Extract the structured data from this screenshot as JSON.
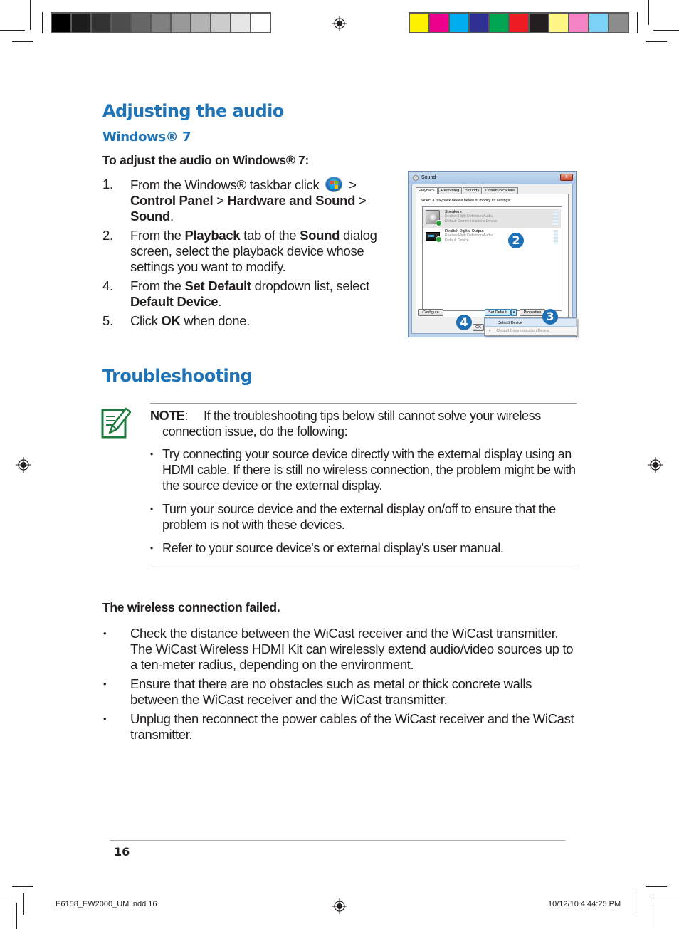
{
  "printer_marks": {
    "gray_swatches": [
      "#000000",
      "#1c1c1c",
      "#333333",
      "#4d4d4d",
      "#666666",
      "#808080",
      "#999999",
      "#b3b3b3",
      "#cccccc",
      "#e6e6e6",
      "#ffffff"
    ],
    "color_swatches": [
      "#fff200",
      "#ec008c",
      "#00aeef",
      "#2e3192",
      "#00a651",
      "#ed1c24",
      "#231f20",
      "#fff685",
      "#f584c5",
      "#7dd3f7",
      "#8c8c8c"
    ]
  },
  "section_audio": {
    "title": "Adjusting the audio",
    "subtitle": "Windows® 7",
    "procedure_heading": "To adjust the audio on Windows® 7:",
    "steps": [
      {
        "num": "1.",
        "parts": [
          {
            "t": "From the Windows® taskbar click ",
            "b": false
          },
          {
            "icon": "windows-start-orb-icon"
          },
          {
            "t": " > ",
            "b": false
          },
          {
            "t": "Control Panel",
            "b": true
          },
          {
            "t": " > ",
            "b": false
          },
          {
            "t": "Hardware and Sound",
            "b": true
          },
          {
            "t": " > ",
            "b": false
          },
          {
            "t": "Sound",
            "b": true
          },
          {
            "t": ".",
            "b": false
          }
        ]
      },
      {
        "num": "2.",
        "parts": [
          {
            "t": "From the ",
            "b": false
          },
          {
            "t": "Playback",
            "b": true
          },
          {
            "t": " tab of the ",
            "b": false
          },
          {
            "t": "Sound",
            "b": true
          },
          {
            "t": " dialog screen, select the playback device whose settings you want to modify.",
            "b": false
          }
        ]
      },
      {
        "num": "4.",
        "parts": [
          {
            "t": "From the ",
            "b": false
          },
          {
            "t": "Set Default",
            "b": true
          },
          {
            "t": " dropdown list, select ",
            "b": false
          },
          {
            "t": "Default Device",
            "b": true
          },
          {
            "t": ".",
            "b": false
          }
        ]
      },
      {
        "num": "5.",
        "parts": [
          {
            "t": "Click ",
            "b": false
          },
          {
            "t": "OK",
            "b": true
          },
          {
            "t": " when done.",
            "b": false
          }
        ]
      }
    ]
  },
  "sound_dialog": {
    "title": "Sound",
    "close_label": "x",
    "tabs": [
      "Playback",
      "Recording",
      "Sounds",
      "Communications"
    ],
    "active_tab": "Playback",
    "instruction": "Select a playback device below to modify its settings:",
    "devices": [
      {
        "name": "Speakers",
        "driver": "Realtek High Definition Audio",
        "status": "Default Communications Device",
        "selected": true
      },
      {
        "name": "Realtek Digital Output",
        "driver": "Realtek High Definition Audio",
        "status": "Default Device",
        "selected": false
      }
    ],
    "buttons": {
      "configure": "Configure",
      "set_default": "Set Default",
      "properties": "Properties",
      "ok": "OK"
    },
    "dropdown_menu": [
      {
        "label": "Default Device",
        "checked": false,
        "highlighted": true
      },
      {
        "label": "Default Communication Device",
        "checked": true,
        "highlighted": false
      }
    ],
    "check_glyph": "✓",
    "callouts": [
      "2",
      "3",
      "4"
    ]
  },
  "section_troubleshooting": {
    "title": "Troubleshooting",
    "note": {
      "label": "NOTE",
      "colon": ":",
      "text": "If the troubleshooting tips below still cannot solve your wireless connection issue, do the following:",
      "tips": [
        "Try connecting your source device directly with the external display using an HDMI cable. If there is still no wireless connection, the problem might be with the source device or the external display.",
        "Turn your source device and the external display on/off to ensure that the problem is not with these devices.",
        "Refer to your source device's or external display's user manual."
      ],
      "bullet": "•"
    },
    "problem_heading": "The wireless connection failed.",
    "solutions": [
      "Check the distance between the WiCast receiver and the WiCast transmitter. The WiCast Wireless HDMI Kit can wirelessly extend audio/video sources up to a ten-meter radius, depending on the environment.",
      "Ensure that there are no obstacles such as metal or thick concrete walls between the WiCast receiver and the WiCast transmitter.",
      "Unplug then reconnect the power cables of the WiCast receiver and the WiCast transmitter."
    ]
  },
  "footer": {
    "page_number": "16",
    "slug_file": "E6158_EW2000_UM.indd   16",
    "slug_date": "10/12/10   4:44:25 PM"
  },
  "colors": {
    "heading_blue": "#1f73b7",
    "note_green": "#1e7a3c",
    "callout_blue": "#1f6fb5"
  }
}
